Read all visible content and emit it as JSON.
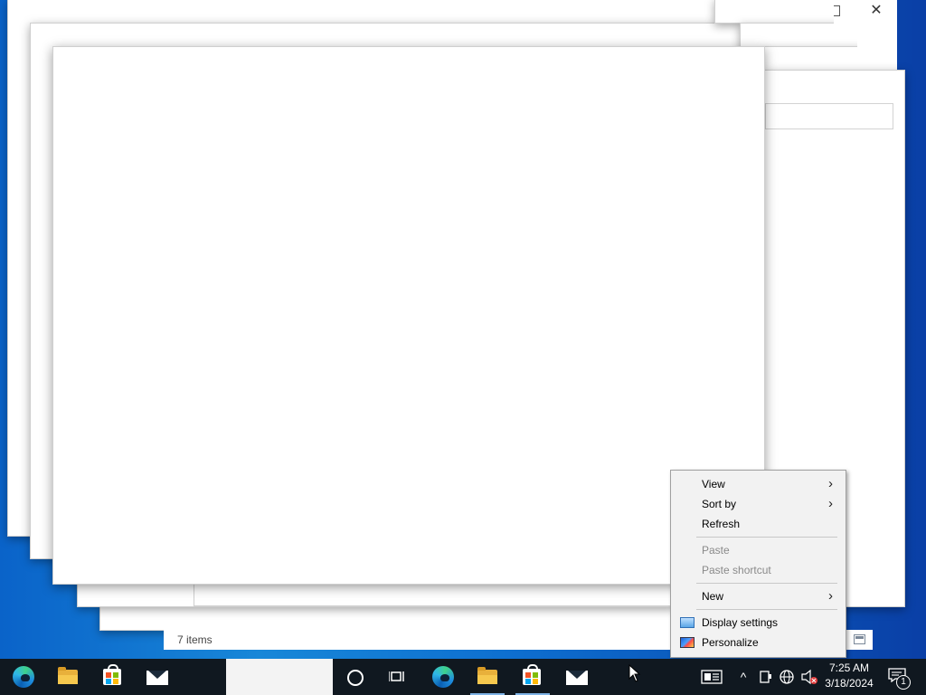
{
  "explorer": {
    "status_items": "7 items"
  },
  "context_menu": {
    "items": [
      {
        "label": "View",
        "disabled": false,
        "submenu": true
      },
      {
        "label": "Sort by",
        "disabled": false,
        "submenu": true
      },
      {
        "label": "Refresh",
        "disabled": false,
        "submenu": false
      },
      {
        "label": "Paste",
        "disabled": true,
        "submenu": false
      },
      {
        "label": "Paste shortcut",
        "disabled": true,
        "submenu": false
      },
      {
        "label": "New",
        "disabled": false,
        "submenu": true
      },
      {
        "label": "Display settings",
        "disabled": false,
        "submenu": false,
        "icon": "display-icon"
      },
      {
        "label": "Personalize",
        "disabled": false,
        "submenu": false,
        "icon": "personalize-icon"
      }
    ],
    "submenu_glyph": "›"
  },
  "taskbar": {
    "apps": [
      {
        "name": "edge",
        "icon": "edge-icon"
      },
      {
        "name": "file-explorer",
        "icon": "folder-icon"
      },
      {
        "name": "store",
        "icon": "store-icon"
      },
      {
        "name": "mail",
        "icon": "mail-icon"
      },
      {
        "name": "cortana",
        "icon": "cortana-icon"
      },
      {
        "name": "task-view",
        "icon": "task-view-icon"
      },
      {
        "name": "edge",
        "icon": "edge-icon"
      },
      {
        "name": "file-explorer",
        "icon": "folder-icon"
      },
      {
        "name": "store",
        "icon": "store-icon"
      },
      {
        "name": "mail",
        "icon": "mail-icon"
      }
    ],
    "tray": {
      "news_icon": "news-icon",
      "chevron": "^",
      "time": "7:25 AM",
      "date": "3/18/2024",
      "notification_count": "1"
    }
  },
  "colors": {
    "desktop_blue": "#0a63c9",
    "taskbar": "#101820",
    "menu_bg": "#f2f2f2",
    "menu_disabled_text": "#8a8a8a"
  }
}
